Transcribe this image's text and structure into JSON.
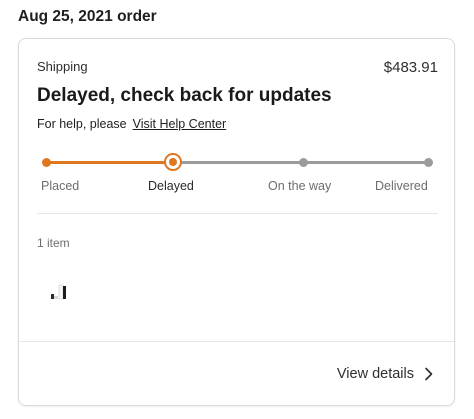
{
  "order_date": "Aug 25, 2021 order",
  "card": {
    "shipping_label": "Shipping",
    "price": "$483.91",
    "status_title": "Delayed, check back for updates",
    "help_text": "For help, please",
    "help_link": "Visit Help Center",
    "progress": {
      "steps": [
        "Placed",
        "Delayed",
        "On the way",
        "Delivered"
      ],
      "current_step": 1,
      "colors": {
        "active": "#e0761e",
        "inactive": "#9b9b9b"
      }
    },
    "item_count": "1 item",
    "view_details": "View details",
    "icons": {
      "view_details": "chevron-right-icon"
    }
  }
}
